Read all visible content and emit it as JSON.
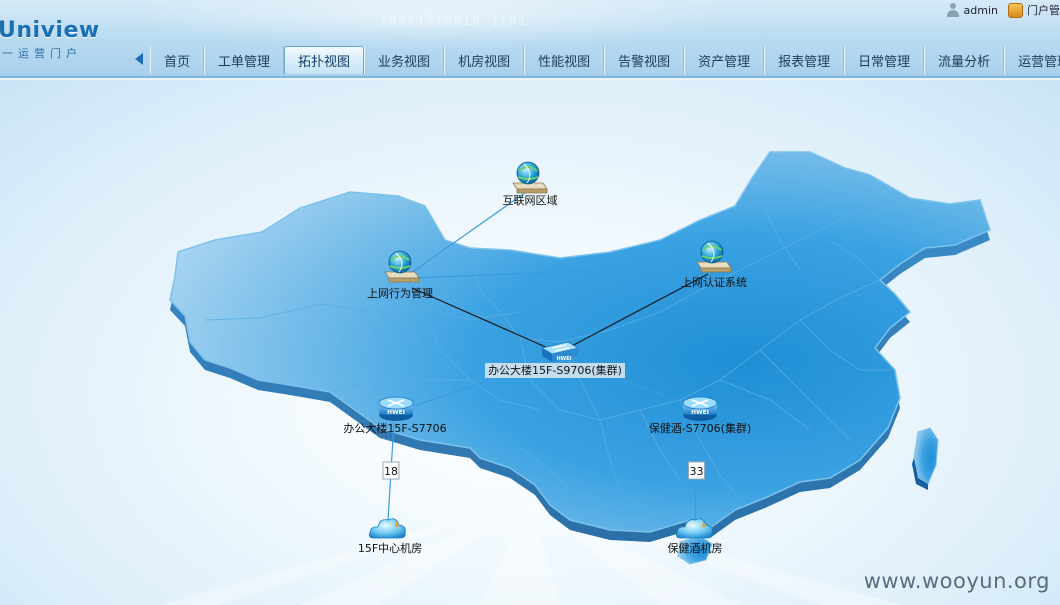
{
  "header": {
    "logo_title": "Uniview",
    "logo_subtitle": "一运营门户",
    "binary_text": "10001110010 1101",
    "user_name": "admin",
    "portal_label": "门户管"
  },
  "nav": {
    "tabs": [
      {
        "label": "首页",
        "active": false
      },
      {
        "label": "工单管理",
        "active": false
      },
      {
        "label": "拓扑视图",
        "active": true
      },
      {
        "label": "业务视图",
        "active": false
      },
      {
        "label": "机房视图",
        "active": false
      },
      {
        "label": "性能视图",
        "active": false
      },
      {
        "label": "告警视图",
        "active": false
      },
      {
        "label": "资产管理",
        "active": false
      },
      {
        "label": "报表管理",
        "active": false
      },
      {
        "label": "日常管理",
        "active": false
      },
      {
        "label": "流量分析",
        "active": false
      },
      {
        "label": "运营管理",
        "active": false
      }
    ]
  },
  "topology": {
    "nodes": [
      {
        "id": "internet",
        "label": "互联网区域",
        "type": "server-globe"
      },
      {
        "id": "behavior",
        "label": "上网行为管理",
        "type": "server-globe"
      },
      {
        "id": "auth",
        "label": "上网认证系统",
        "type": "server-globe"
      },
      {
        "id": "s9706",
        "label": "办公大楼15F-S9706(集群)",
        "type": "switch"
      },
      {
        "id": "s7706a",
        "label": "办公大楼15F-S7706",
        "type": "router"
      },
      {
        "id": "s7706b",
        "label": "保健酒-S7706(集群)",
        "type": "router"
      },
      {
        "id": "room15f",
        "label": "15F中心机房",
        "type": "cloud"
      },
      {
        "id": "roomjiu",
        "label": "保健酒机房",
        "type": "cloud"
      }
    ],
    "links": [
      {
        "from": "internet",
        "to": "behavior",
        "style": "blue",
        "label": ""
      },
      {
        "from": "behavior",
        "to": "auth",
        "style": "blue",
        "label": ""
      },
      {
        "from": "behavior",
        "to": "s9706",
        "style": "black",
        "label": ""
      },
      {
        "from": "auth",
        "to": "s9706",
        "style": "black",
        "label": ""
      },
      {
        "from": "s9706",
        "to": "s7706a",
        "style": "blue",
        "label": ""
      },
      {
        "from": "s9706",
        "to": "s7706b",
        "style": "blue",
        "label": ""
      },
      {
        "from": "s7706a",
        "to": "room15f",
        "style": "blue",
        "label": "18"
      },
      {
        "from": "s7706b",
        "to": "roomjiu",
        "style": "blue",
        "label": "33"
      }
    ],
    "device_brand": "HWEI"
  },
  "watermark": "www.wooyun.org",
  "colors": {
    "map_fill_light": "#a9d3ef",
    "map_fill_dark": "#1e8bd0",
    "map_border": "#6fb4e3",
    "link_blue": "#3a9be0",
    "link_black": "#1a1a1a",
    "accent": "#1b6fb3"
  }
}
